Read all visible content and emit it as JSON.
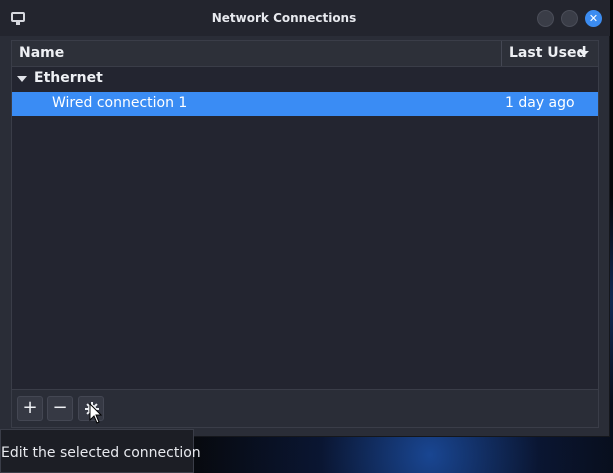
{
  "window": {
    "title": "Network Connections",
    "close_glyph": "✕"
  },
  "list": {
    "columns": {
      "name": "Name",
      "last_used": "Last Used"
    },
    "groups": [
      {
        "label": "Ethernet",
        "connections": [
          {
            "name": "Wired connection 1",
            "last_used": "1 day ago",
            "selected": true
          }
        ]
      }
    ]
  },
  "toolbar": {
    "add_glyph": "+",
    "remove_glyph": "−",
    "edit_icon": "gear-icon"
  },
  "tooltip": {
    "text": "Edit the selected connection"
  },
  "colors": {
    "accent": "#3a8cf4",
    "window_bg": "#2a2d37",
    "list_bg": "#232530"
  }
}
